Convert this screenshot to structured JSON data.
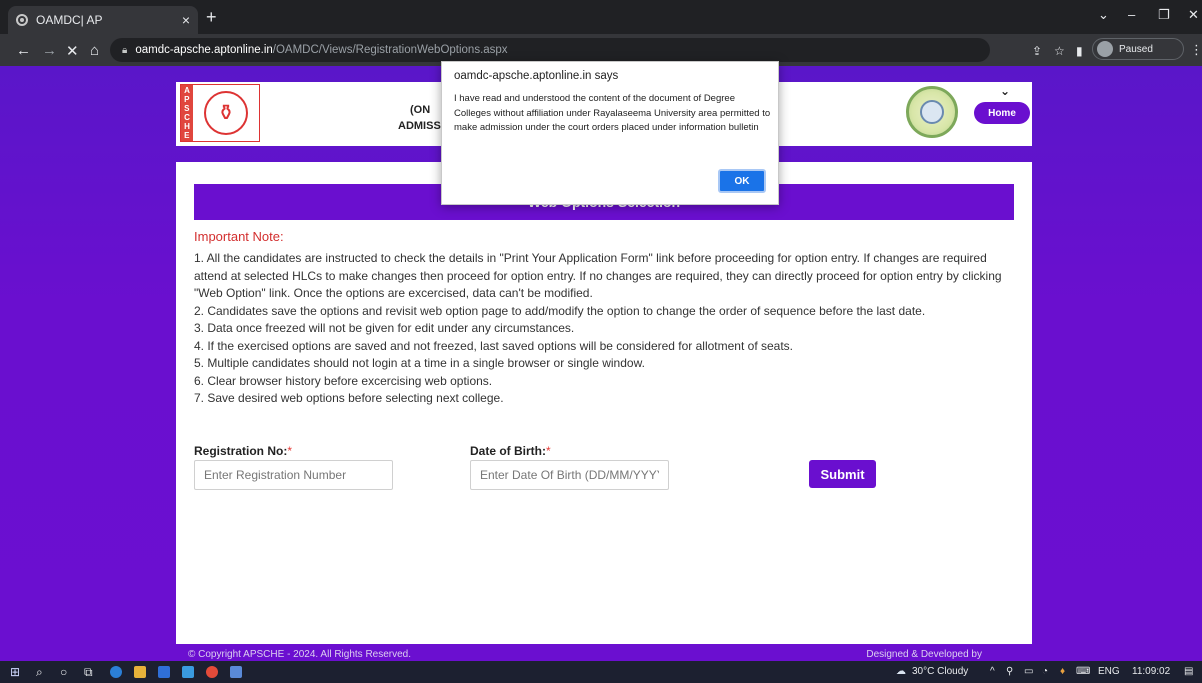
{
  "browser": {
    "tab_title": "OAMDC| AP",
    "tab_close": "×",
    "new_tab": "+",
    "url_host": "oamdc-apsche.aptonline.in",
    "url_path": "/OAMDC/Views/RegistrationWebOptions.aspx",
    "profile_status": "Paused",
    "nav": {
      "back": "←",
      "forward": "→",
      "stop": "✕",
      "home": "⌂"
    }
  },
  "header": {
    "left_logo_letters": "APSCHE",
    "left_logo_text": "",
    "title_line1": "(ON",
    "title_line2": "ADMISSIOI",
    "menu_chevron": "⌄",
    "home_label": "Home"
  },
  "main": {
    "banner_title": "Web Options Selection",
    "important_note": "Important Note:",
    "notes": [
      "1. All the candidates are instructed to check the details in \"Print Your Application Form\" link before proceeding for option entry. If changes are required attend at selected HLCs to make changes then proceed for option entry. If no changes are required, they can directly proceed for option entry by clicking \"Web Option\" link. Once the options are excercised, data can't be modified.",
      "2. Candidates save the options and revisit web option page to add/modify the option to change the order of sequence before the last date.",
      "3. Data once freezed will not be given for edit under any circumstances.",
      "4. If the exercised options are saved and not freezed, last saved options will be considered for allotment of seats.",
      "5. Multiple candidates should not login at a time in a single browser or single window.",
      "6. Clear browser history before excercising web options.",
      "7. Save desired web options before selecting next college."
    ],
    "form": {
      "registration_label": "Registration No:",
      "registration_placeholder": "Enter Registration Number",
      "dob_label": "Date of Birth:",
      "dob_placeholder": "Enter Date Of Birth (DD/MM/YYYY)",
      "required_mark": "*",
      "submit_label": "Submit"
    }
  },
  "footer": {
    "left": "© Copyright APSCHE - 2024. All Rights Reserved.",
    "right": "Designed & Developed by"
  },
  "dialog": {
    "title": "oamdc-apsche.aptonline.in says",
    "message": "I have read and understood the content of the document of Degree Colleges without affiliation under Rayalaseema University area permitted to make admission under the court orders placed under information bulletin",
    "ok_label": "OK"
  },
  "taskbar": {
    "weather": "30°C Cloudy",
    "language": "ENG",
    "time": "11:09:02"
  },
  "colors": {
    "brand_purple": "#6a0fcf",
    "note_red": "#d32f2f",
    "ok_blue": "#1a73e8"
  }
}
